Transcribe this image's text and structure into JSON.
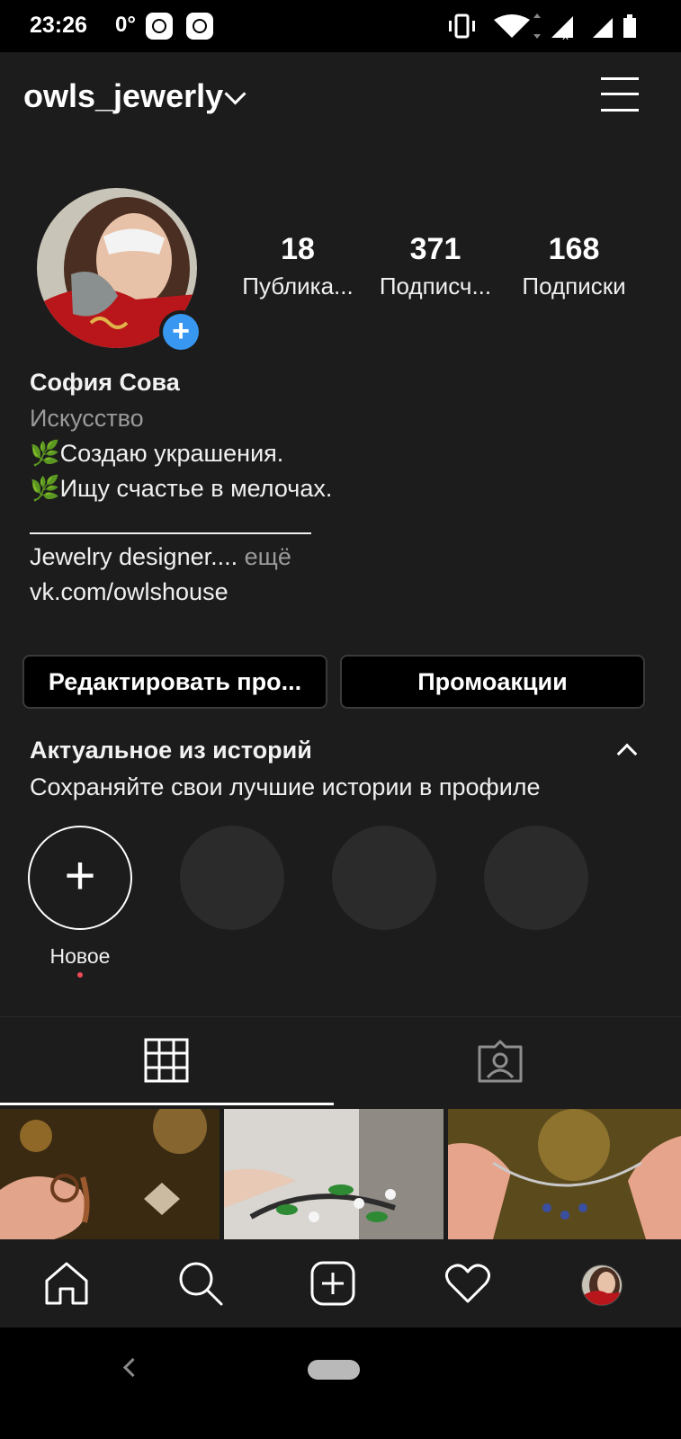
{
  "status_bar": {
    "time": "23:26",
    "temperature": "0°"
  },
  "header": {
    "username": "owls_jewerly"
  },
  "profile": {
    "stats": [
      {
        "value": "18",
        "label": "Публика..."
      },
      {
        "value": "371",
        "label": "Подписч..."
      },
      {
        "value": "168",
        "label": "Подписки"
      }
    ],
    "full_name": "София Сова",
    "category": "Искусство",
    "bio_lines": [
      "🌿Создаю украшения.",
      "🌿Ищу счастье в мелочах."
    ],
    "bio_text": "Jewelry designer....",
    "bio_more": " ещё",
    "link": "vk.com/owlshouse"
  },
  "buttons": {
    "edit_profile": "Редактировать про...",
    "promotions": "Промоакции"
  },
  "highlights": {
    "title": "Актуальное из историй",
    "subtitle": "Сохраняйте свои лучшие истории в профиле",
    "new_label": "Новое"
  },
  "colors": {
    "background": "#1c1c1c",
    "accent": "#3897f0",
    "notification_dot": "#ed4956",
    "secondary_text": "#9a9a9a"
  },
  "icons": {
    "header": [
      "chevron-down-icon",
      "menu-icon"
    ],
    "tabs": [
      "grid-icon",
      "tagged-icon"
    ],
    "bottom_nav": [
      "home-icon",
      "search-icon",
      "new-post-icon",
      "heart-icon",
      "profile-avatar"
    ]
  }
}
